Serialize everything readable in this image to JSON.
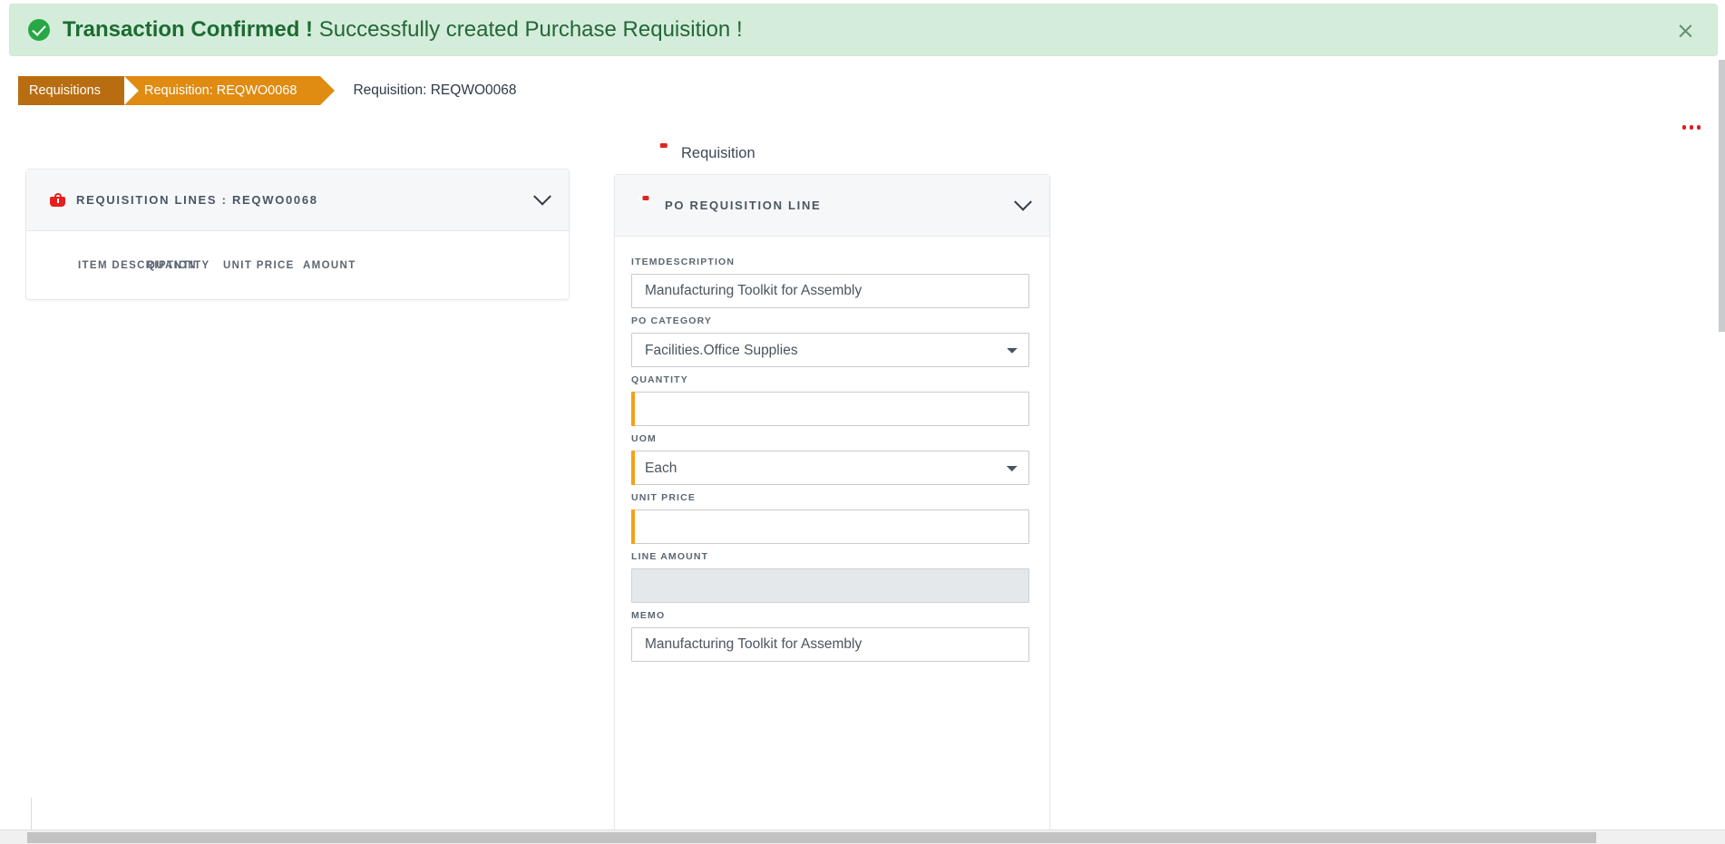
{
  "banner": {
    "icon": "check-circle-icon",
    "strong_text": "Transaction Confirmed !",
    "message": "Successfully created Purchase Requisition !",
    "close_label": "×",
    "background_color": "#d4edda",
    "accent_color": "#28a745"
  },
  "breadcrumb": {
    "items": [
      {
        "label": "Requisitions",
        "color": "#b86d10"
      },
      {
        "label": "Requisition: REQWO0068",
        "color": "#e08b11"
      }
    ],
    "page_title": "Requisition: REQWO0068"
  },
  "overflow_menu": {
    "name": "ellipsis-menu",
    "color": "#e01b24"
  },
  "tab": {
    "icon": "clipboard-check-icon",
    "label": "Requisition"
  },
  "lines_panel": {
    "icon": "shopping-basket-icon",
    "title": "REQUISITION LINES : REQWO0068",
    "collapse_icon": "chevron-down-icon",
    "columns": [
      "ITEM DESCRIPTION",
      "QUANTITY",
      "UNIT PRICE",
      "AMOUNT"
    ],
    "rows": []
  },
  "po_line_panel": {
    "icon": "clipboard-check-icon",
    "title": "PO REQUISITION LINE",
    "collapse_icon": "chevron-down-icon",
    "required_marker_color": "#f5a117",
    "fields": {
      "item_description": {
        "label": "ITEMDESCRIPTION",
        "value": "Manufacturing Toolkit for Assembly",
        "type": "text",
        "required": false,
        "readonly": false
      },
      "po_category": {
        "label": "PO CATEGORY",
        "value": "Facilities.Office Supplies",
        "type": "select",
        "required": false,
        "readonly": false,
        "options": [
          "Facilities.Office Supplies"
        ]
      },
      "quantity": {
        "label": "QUANTITY",
        "value": "",
        "type": "text",
        "required": true,
        "readonly": false
      },
      "uom": {
        "label": "UOM",
        "value": "Each",
        "type": "select",
        "required": true,
        "readonly": false,
        "options": [
          "Each"
        ]
      },
      "unit_price": {
        "label": "UNIT PRICE",
        "value": "",
        "type": "text",
        "required": true,
        "readonly": false
      },
      "line_amount": {
        "label": "LINE AMOUNT",
        "value": "",
        "type": "text",
        "required": false,
        "readonly": true
      },
      "memo": {
        "label": "MEMO",
        "value": "Manufacturing Toolkit for Assembly",
        "type": "text",
        "required": false,
        "readonly": false
      }
    }
  }
}
